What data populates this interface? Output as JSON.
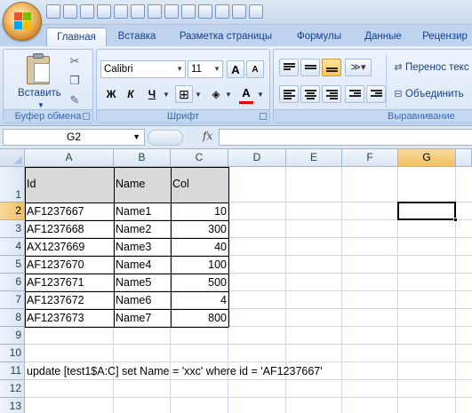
{
  "qat": {
    "icons": [
      "save-icon",
      "undo-icon",
      "redo-icon",
      "open-folder-icon",
      "filter-icon",
      "sort-icon",
      "chart-icon",
      "table-icon",
      "print-preview-icon",
      "grid-icon",
      "border-icon",
      "fill-icon",
      "shape-icon"
    ]
  },
  "tabs": [
    "Главная",
    "Вставка",
    "Разметка страницы",
    "Формулы",
    "Данные",
    "Рецензир"
  ],
  "ribbon": {
    "clipboard": {
      "paste": "Вставить",
      "label": "Буфер обмена"
    },
    "font": {
      "name": "Calibri",
      "size": "11",
      "bold": "Ж",
      "italic": "К",
      "underline": "Ч",
      "grow": "A",
      "shrink": "A",
      "color_letter": "A",
      "label": "Шрифт"
    },
    "alignment": {
      "wrap": "Перенос текс",
      "merge": "Объединить",
      "label": "Выравнивание"
    }
  },
  "formula_bar": {
    "cell_ref": "G2",
    "fx": "fx",
    "value": ""
  },
  "sheet": {
    "columns": [
      "A",
      "B",
      "C",
      "D",
      "E",
      "F",
      "G"
    ],
    "rows": [
      "1",
      "2",
      "3",
      "4",
      "5",
      "6",
      "7",
      "8",
      "9",
      "10",
      "11",
      "12",
      "13"
    ],
    "header": [
      "Id",
      "Name",
      "Col"
    ],
    "data": [
      [
        "AF1237667",
        "Name1",
        "10"
      ],
      [
        "AF1237668",
        "Name2",
        "300"
      ],
      [
        "AX1237669",
        "Name3",
        "40"
      ],
      [
        "AF1237670",
        "Name4",
        "100"
      ],
      [
        "AF1237671",
        "Name5",
        "500"
      ],
      [
        "AF1237672",
        "Name6",
        "4"
      ],
      [
        "AF1237673",
        "Name7",
        "800"
      ]
    ],
    "note": "update [test1$A:C] set Name = 'xxc' where id = 'AF1237667'",
    "selected_cell": "G2"
  }
}
